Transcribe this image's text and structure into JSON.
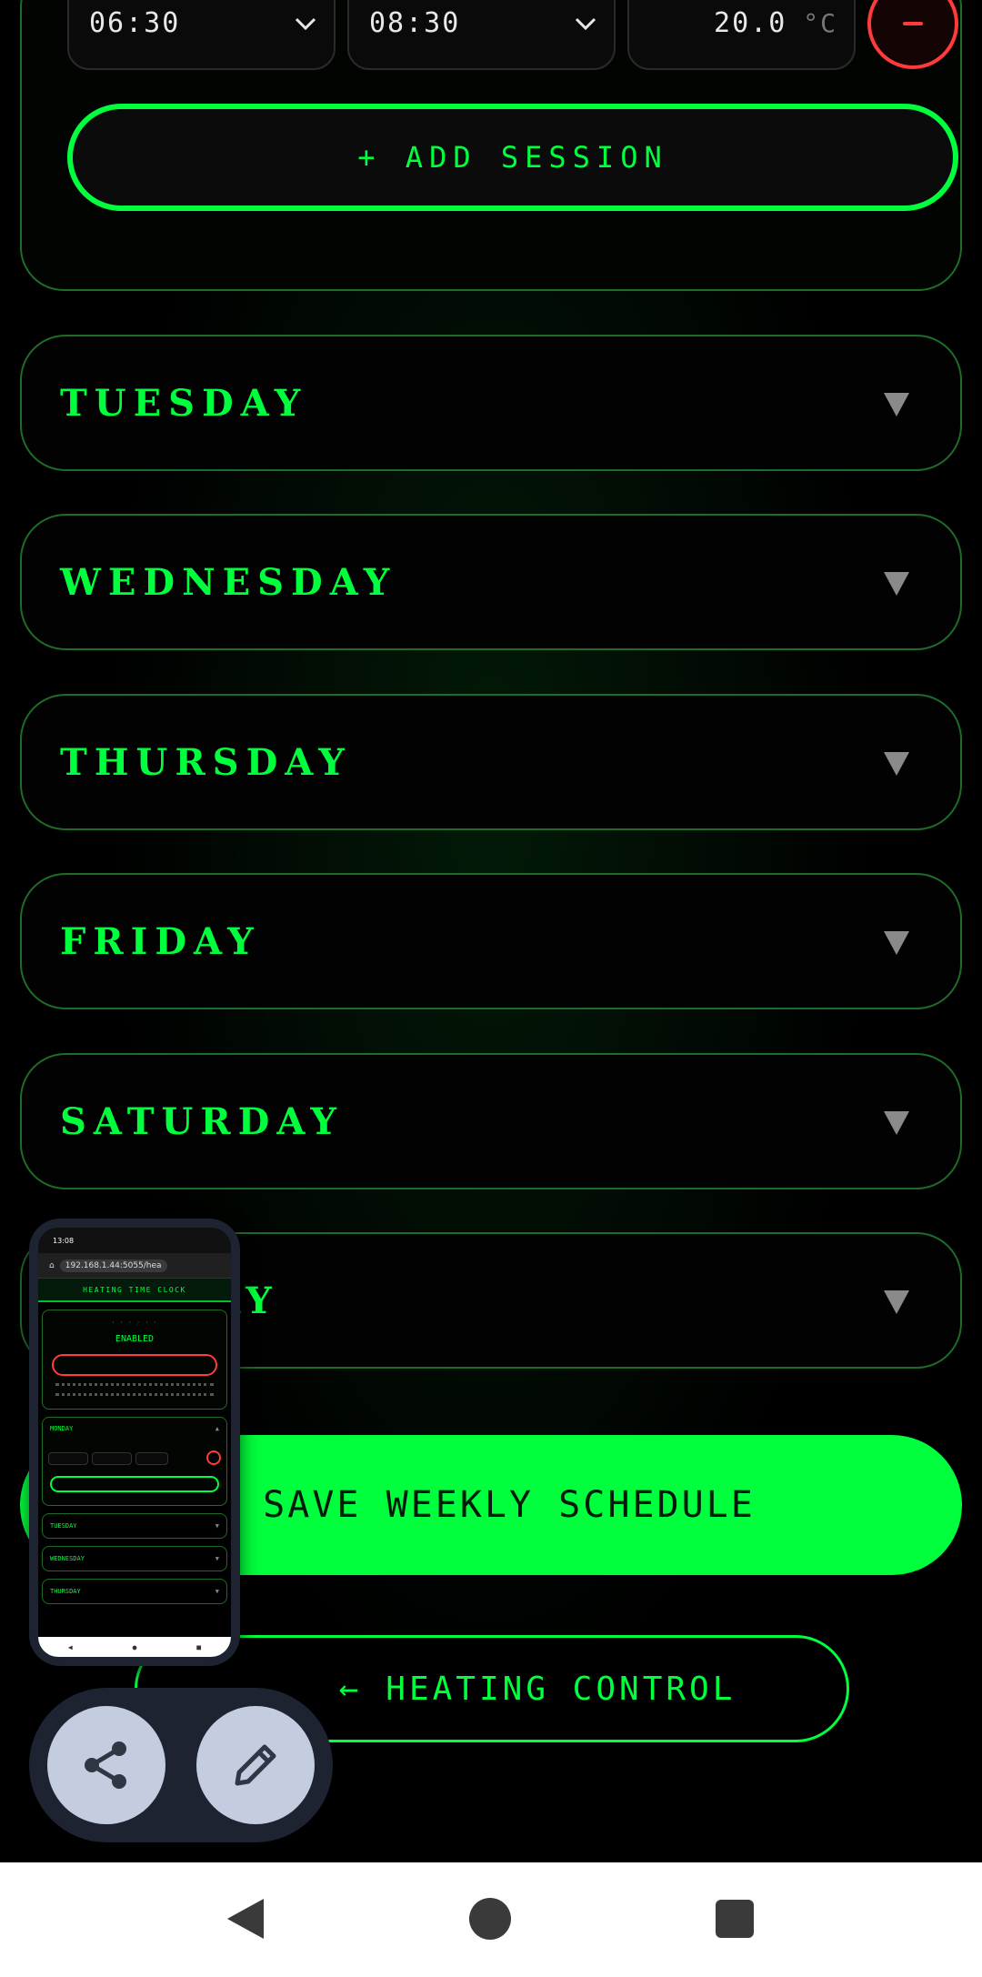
{
  "monday_session": {
    "start_time": "06:30",
    "end_time": "08:30",
    "temperature": "20.0",
    "unit": "°C",
    "remove_label": "−"
  },
  "add_session_label": "+ ADD SESSION",
  "days": [
    "TUESDAY",
    "WEDNESDAY",
    "THURSDAY",
    "FRIDAY",
    "SATURDAY",
    "SUNDAY"
  ],
  "save_label": "SAVE WEEKLY SCHEDULE",
  "heating_control_label": "HEATING CONTROL",
  "heating_control_arrow": "←",
  "mini_preview": {
    "time": "13:08",
    "url": "192.168.1.44:5055/hea",
    "header": "HEATING TIME CLOCK",
    "status_value": "ENABLED",
    "monday": "MONDAY",
    "days": [
      "TUESDAY",
      "WEDNESDAY",
      "THURSDAY"
    ]
  },
  "colors": {
    "accent": "#00ff3c",
    "danger": "#ff3b3b",
    "border": "#1f6b28"
  }
}
